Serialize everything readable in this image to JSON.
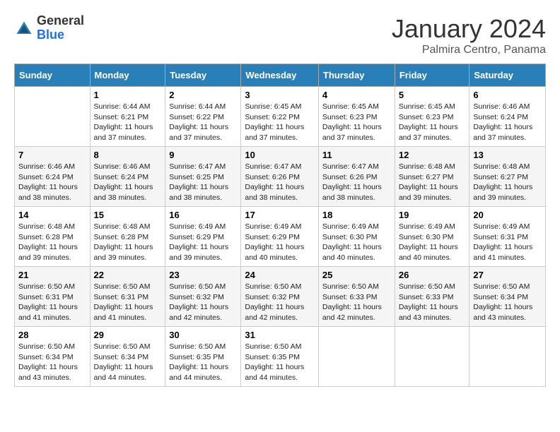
{
  "header": {
    "logo_general": "General",
    "logo_blue": "Blue",
    "month_year": "January 2024",
    "location": "Palmira Centro, Panama"
  },
  "weekdays": [
    "Sunday",
    "Monday",
    "Tuesday",
    "Wednesday",
    "Thursday",
    "Friday",
    "Saturday"
  ],
  "weeks": [
    [
      {
        "day": "",
        "sunrise": "",
        "sunset": "",
        "daylight": ""
      },
      {
        "day": "1",
        "sunrise": "Sunrise: 6:44 AM",
        "sunset": "Sunset: 6:21 PM",
        "daylight": "Daylight: 11 hours and 37 minutes."
      },
      {
        "day": "2",
        "sunrise": "Sunrise: 6:44 AM",
        "sunset": "Sunset: 6:22 PM",
        "daylight": "Daylight: 11 hours and 37 minutes."
      },
      {
        "day": "3",
        "sunrise": "Sunrise: 6:45 AM",
        "sunset": "Sunset: 6:22 PM",
        "daylight": "Daylight: 11 hours and 37 minutes."
      },
      {
        "day": "4",
        "sunrise": "Sunrise: 6:45 AM",
        "sunset": "Sunset: 6:23 PM",
        "daylight": "Daylight: 11 hours and 37 minutes."
      },
      {
        "day": "5",
        "sunrise": "Sunrise: 6:45 AM",
        "sunset": "Sunset: 6:23 PM",
        "daylight": "Daylight: 11 hours and 37 minutes."
      },
      {
        "day": "6",
        "sunrise": "Sunrise: 6:46 AM",
        "sunset": "Sunset: 6:24 PM",
        "daylight": "Daylight: 11 hours and 37 minutes."
      }
    ],
    [
      {
        "day": "7",
        "sunrise": "Sunrise: 6:46 AM",
        "sunset": "Sunset: 6:24 PM",
        "daylight": "Daylight: 11 hours and 38 minutes."
      },
      {
        "day": "8",
        "sunrise": "Sunrise: 6:46 AM",
        "sunset": "Sunset: 6:24 PM",
        "daylight": "Daylight: 11 hours and 38 minutes."
      },
      {
        "day": "9",
        "sunrise": "Sunrise: 6:47 AM",
        "sunset": "Sunset: 6:25 PM",
        "daylight": "Daylight: 11 hours and 38 minutes."
      },
      {
        "day": "10",
        "sunrise": "Sunrise: 6:47 AM",
        "sunset": "Sunset: 6:26 PM",
        "daylight": "Daylight: 11 hours and 38 minutes."
      },
      {
        "day": "11",
        "sunrise": "Sunrise: 6:47 AM",
        "sunset": "Sunset: 6:26 PM",
        "daylight": "Daylight: 11 hours and 38 minutes."
      },
      {
        "day": "12",
        "sunrise": "Sunrise: 6:48 AM",
        "sunset": "Sunset: 6:27 PM",
        "daylight": "Daylight: 11 hours and 39 minutes."
      },
      {
        "day": "13",
        "sunrise": "Sunrise: 6:48 AM",
        "sunset": "Sunset: 6:27 PM",
        "daylight": "Daylight: 11 hours and 39 minutes."
      }
    ],
    [
      {
        "day": "14",
        "sunrise": "Sunrise: 6:48 AM",
        "sunset": "Sunset: 6:28 PM",
        "daylight": "Daylight: 11 hours and 39 minutes."
      },
      {
        "day": "15",
        "sunrise": "Sunrise: 6:48 AM",
        "sunset": "Sunset: 6:28 PM",
        "daylight": "Daylight: 11 hours and 39 minutes."
      },
      {
        "day": "16",
        "sunrise": "Sunrise: 6:49 AM",
        "sunset": "Sunset: 6:29 PM",
        "daylight": "Daylight: 11 hours and 39 minutes."
      },
      {
        "day": "17",
        "sunrise": "Sunrise: 6:49 AM",
        "sunset": "Sunset: 6:29 PM",
        "daylight": "Daylight: 11 hours and 40 minutes."
      },
      {
        "day": "18",
        "sunrise": "Sunrise: 6:49 AM",
        "sunset": "Sunset: 6:30 PM",
        "daylight": "Daylight: 11 hours and 40 minutes."
      },
      {
        "day": "19",
        "sunrise": "Sunrise: 6:49 AM",
        "sunset": "Sunset: 6:30 PM",
        "daylight": "Daylight: 11 hours and 40 minutes."
      },
      {
        "day": "20",
        "sunrise": "Sunrise: 6:49 AM",
        "sunset": "Sunset: 6:31 PM",
        "daylight": "Daylight: 11 hours and 41 minutes."
      }
    ],
    [
      {
        "day": "21",
        "sunrise": "Sunrise: 6:50 AM",
        "sunset": "Sunset: 6:31 PM",
        "daylight": "Daylight: 11 hours and 41 minutes."
      },
      {
        "day": "22",
        "sunrise": "Sunrise: 6:50 AM",
        "sunset": "Sunset: 6:31 PM",
        "daylight": "Daylight: 11 hours and 41 minutes."
      },
      {
        "day": "23",
        "sunrise": "Sunrise: 6:50 AM",
        "sunset": "Sunset: 6:32 PM",
        "daylight": "Daylight: 11 hours and 42 minutes."
      },
      {
        "day": "24",
        "sunrise": "Sunrise: 6:50 AM",
        "sunset": "Sunset: 6:32 PM",
        "daylight": "Daylight: 11 hours and 42 minutes."
      },
      {
        "day": "25",
        "sunrise": "Sunrise: 6:50 AM",
        "sunset": "Sunset: 6:33 PM",
        "daylight": "Daylight: 11 hours and 42 minutes."
      },
      {
        "day": "26",
        "sunrise": "Sunrise: 6:50 AM",
        "sunset": "Sunset: 6:33 PM",
        "daylight": "Daylight: 11 hours and 43 minutes."
      },
      {
        "day": "27",
        "sunrise": "Sunrise: 6:50 AM",
        "sunset": "Sunset: 6:34 PM",
        "daylight": "Daylight: 11 hours and 43 minutes."
      }
    ],
    [
      {
        "day": "28",
        "sunrise": "Sunrise: 6:50 AM",
        "sunset": "Sunset: 6:34 PM",
        "daylight": "Daylight: 11 hours and 43 minutes."
      },
      {
        "day": "29",
        "sunrise": "Sunrise: 6:50 AM",
        "sunset": "Sunset: 6:34 PM",
        "daylight": "Daylight: 11 hours and 44 minutes."
      },
      {
        "day": "30",
        "sunrise": "Sunrise: 6:50 AM",
        "sunset": "Sunset: 6:35 PM",
        "daylight": "Daylight: 11 hours and 44 minutes."
      },
      {
        "day": "31",
        "sunrise": "Sunrise: 6:50 AM",
        "sunset": "Sunset: 6:35 PM",
        "daylight": "Daylight: 11 hours and 44 minutes."
      },
      {
        "day": "",
        "sunrise": "",
        "sunset": "",
        "daylight": ""
      },
      {
        "day": "",
        "sunrise": "",
        "sunset": "",
        "daylight": ""
      },
      {
        "day": "",
        "sunrise": "",
        "sunset": "",
        "daylight": ""
      }
    ]
  ]
}
